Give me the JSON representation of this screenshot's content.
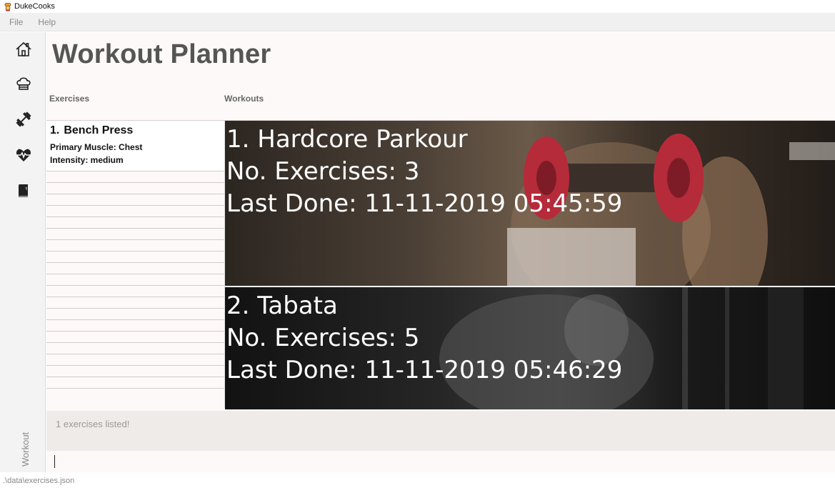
{
  "window": {
    "title": "DukeCooks"
  },
  "menu": {
    "file": "File",
    "help": "Help"
  },
  "sidebar": {
    "items": [
      {
        "icon": "home-icon"
      },
      {
        "icon": "chef-hat-icon"
      },
      {
        "icon": "dumbbell-icon"
      },
      {
        "icon": "heartbeat-icon"
      },
      {
        "icon": "book-icon"
      }
    ],
    "mode_label": "Workout"
  },
  "page": {
    "title": "Workout Planner",
    "exercises_header": "Exercises",
    "workouts_header": "Workouts"
  },
  "exercises": [
    {
      "index": "1.",
      "name": "Bench Press",
      "primary_muscle": "Primary Muscle: Chest",
      "intensity": "Intensity: medium"
    }
  ],
  "workouts": [
    {
      "title": "1. Hardcore Parkour",
      "exercises": "No. Exercises: 3",
      "last_done": "Last Done: 11-11-2019 05:45:59"
    },
    {
      "title": "2. Tabata",
      "exercises": "No. Exercises: 5",
      "last_done": "Last Done: 11-11-2019 05:46:29"
    }
  ],
  "result": {
    "text": "1 exercises listed!"
  },
  "command": {
    "value": ""
  },
  "status": {
    "path": ".\\data\\exercises.json"
  }
}
